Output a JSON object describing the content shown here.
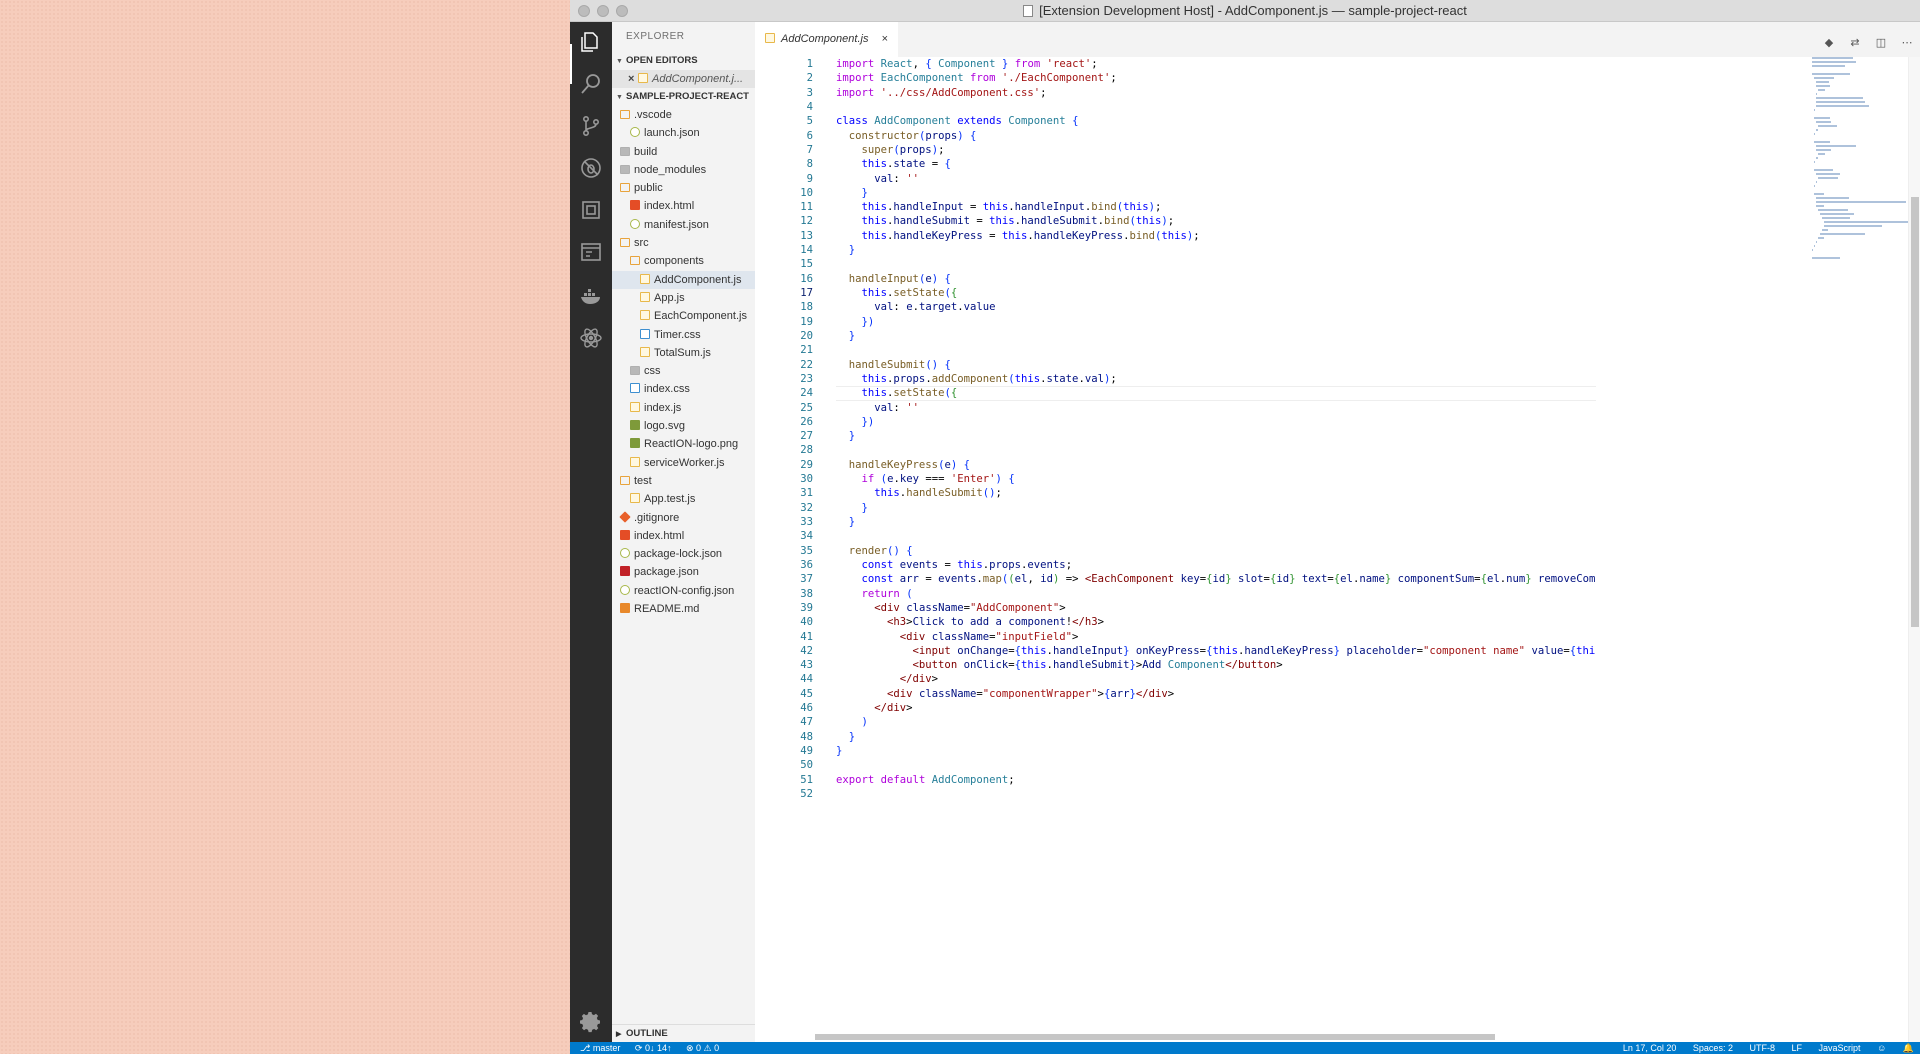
{
  "window": {
    "title": "[Extension Development Host] - AddComponent.js — sample-project-react"
  },
  "sidebar": {
    "header": "EXPLORER",
    "open_editors_label": "OPEN EDITORS",
    "open_editor_file": "AddComponent.j...",
    "project_label": "SAMPLE-PROJECT-REACT",
    "outline_label": "OUTLINE",
    "tree": [
      {
        "label": ".vscode",
        "type": "folder",
        "depth": 0
      },
      {
        "label": "launch.json",
        "type": "json",
        "depth": 1
      },
      {
        "label": "build",
        "type": "folder-gray",
        "depth": 0
      },
      {
        "label": "node_modules",
        "type": "folder-gray",
        "depth": 0
      },
      {
        "label": "public",
        "type": "folder",
        "depth": 0
      },
      {
        "label": "index.html",
        "type": "html",
        "depth": 1
      },
      {
        "label": "manifest.json",
        "type": "json",
        "depth": 1
      },
      {
        "label": "src",
        "type": "folder",
        "depth": 0
      },
      {
        "label": "components",
        "type": "folder",
        "depth": 1
      },
      {
        "label": "AddComponent.js",
        "type": "js",
        "depth": 2,
        "selected": true
      },
      {
        "label": "App.js",
        "type": "js",
        "depth": 2
      },
      {
        "label": "EachComponent.js",
        "type": "js",
        "depth": 2
      },
      {
        "label": "Timer.css",
        "type": "css",
        "depth": 2
      },
      {
        "label": "TotalSum.js",
        "type": "js",
        "depth": 2
      },
      {
        "label": "css",
        "type": "folder-gray",
        "depth": 1
      },
      {
        "label": "index.css",
        "type": "css",
        "depth": 1
      },
      {
        "label": "index.js",
        "type": "js",
        "depth": 1
      },
      {
        "label": "logo.svg",
        "type": "svg",
        "depth": 1
      },
      {
        "label": "ReactION-logo.png",
        "type": "png",
        "depth": 1
      },
      {
        "label": "serviceWorker.js",
        "type": "js",
        "depth": 1
      },
      {
        "label": "test",
        "type": "folder",
        "depth": 0
      },
      {
        "label": "App.test.js",
        "type": "js",
        "depth": 1
      },
      {
        "label": ".gitignore",
        "type": "git",
        "depth": 0
      },
      {
        "label": "index.html",
        "type": "html",
        "depth": 0
      },
      {
        "label": "package-lock.json",
        "type": "json",
        "depth": 0
      },
      {
        "label": "package.json",
        "type": "npm",
        "depth": 0
      },
      {
        "label": "reactION-config.json",
        "type": "json",
        "depth": 0
      },
      {
        "label": "README.md",
        "type": "md",
        "depth": 0
      }
    ]
  },
  "tab": {
    "label": "AddComponent.js",
    "close": "×"
  },
  "editor": {
    "current_line": 17,
    "lines": [
      "import React, { Component } from 'react';",
      "import EachComponent from './EachComponent';",
      "import '../css/AddComponent.css';",
      "",
      "class AddComponent extends Component {",
      "  constructor(props) {",
      "    super(props);",
      "    this.state = {",
      "      val: ''",
      "    }",
      "    this.handleInput = this.handleInput.bind(this);",
      "    this.handleSubmit = this.handleSubmit.bind(this);",
      "    this.handleKeyPress = this.handleKeyPress.bind(this);",
      "  }",
      "",
      "  handleInput(e) {",
      "    this.setState({",
      "      val: e.target.value",
      "    })",
      "  }",
      "",
      "  handleSubmit() {",
      "    this.props.addComponent(this.state.val);",
      "    this.setState({",
      "      val: ''",
      "    })",
      "  }",
      "",
      "  handleKeyPress(e) {",
      "    if (e.key === 'Enter') {",
      "      this.handleSubmit();",
      "    }",
      "  }",
      "",
      "  render() {",
      "    const events = this.props.events;",
      "    const arr = events.map((el, id) => <EachComponent key={id} slot={id} text={el.name} componentSum={el.num} removeComponent={this.props.removeComponent} />);",
      "    return (",
      "      <div className=\"AddComponent\">",
      "        <h3>Click to add a component!</h3>",
      "          <div className=\"inputField\">",
      "            <input onChange={this.handleInput} onKeyPress={this.handleKeyPress} placeholder=\"component name\" value={this.state.val} ref={input => this.input = input} />",
      "            <button onClick={this.handleSubmit}>Add Component</button>",
      "          </div>",
      "        <div className=\"componentWrapper\">{arr}</div>",
      "      </div>",
      "    )",
      "  }",
      "}",
      "",
      "export default AddComponent;",
      ""
    ]
  },
  "statusbar": {
    "branch": "master",
    "sync": "0↓ 14↑",
    "problems": "⊗ 0 ⚠ 0",
    "position": "Ln 17, Col 20",
    "spaces": "Spaces: 2",
    "encoding": "UTF-8",
    "eol": "LF",
    "language": "JavaScript"
  }
}
